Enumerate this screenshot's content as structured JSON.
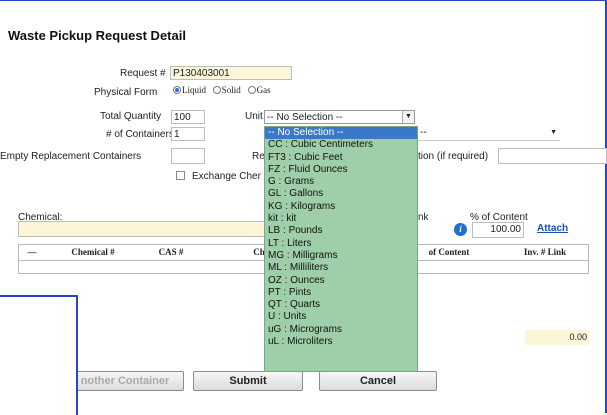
{
  "page": {
    "title": "Waste Pickup Request Detail"
  },
  "form": {
    "request_label": "Request #",
    "request_value": "P130403001",
    "physical_form_label": "Physical Form",
    "physical_form_options": [
      "Liquid",
      "Solid",
      "Gas"
    ],
    "physical_form_selected": "Liquid",
    "total_quantity_label": "Total Quantity",
    "total_quantity_value": "100",
    "unit_label": "Unit",
    "unit_selected": "-- No Selection --",
    "containers_label": "# of Containers",
    "containers_value": "1",
    "select_partial": "--",
    "empty_replacement_label": "Empty Replacement Containers",
    "re_partial": "Re",
    "tion_required_label": "tion (if required)",
    "exchange_label": "Exchange Cher",
    "chemical_label": "Chemical:",
    "nk_partial": "nk",
    "percent_label": "% of Content",
    "percent_value": "100.00",
    "attach_link": "Attach"
  },
  "table": {
    "headers": [
      "—",
      "Chemical #",
      "CAS #",
      "Chemi",
      "of Content",
      "Inv. # Link"
    ]
  },
  "total_value": "0.00",
  "buttons": {
    "another_container": "nother Container",
    "submit": "Submit",
    "cancel": "Cancel"
  },
  "unit_menu": [
    "-- No Selection --",
    "CC : Cubic Centimeters",
    "FT3 : Cubic Feet",
    "FZ : Fluid Ounces",
    "G : Grams",
    "GL : Gallons",
    "KG : Kilograms",
    "kit : kit",
    "LB : Pounds",
    "LT : Liters",
    "MG : Milligrams",
    "ML : Milliliters",
    "OZ : Ounces",
    "PT : Pints",
    "QT : Quarts",
    "U : Units",
    "uG : Micrograms",
    "uL : Microliters"
  ],
  "colors": {
    "frame": "#2b45c8",
    "menu_bg": "#9fcfa8",
    "menu_selected": "#3a78c9",
    "link": "#1a4fb8",
    "field_highlight": "#fbf6d8"
  }
}
